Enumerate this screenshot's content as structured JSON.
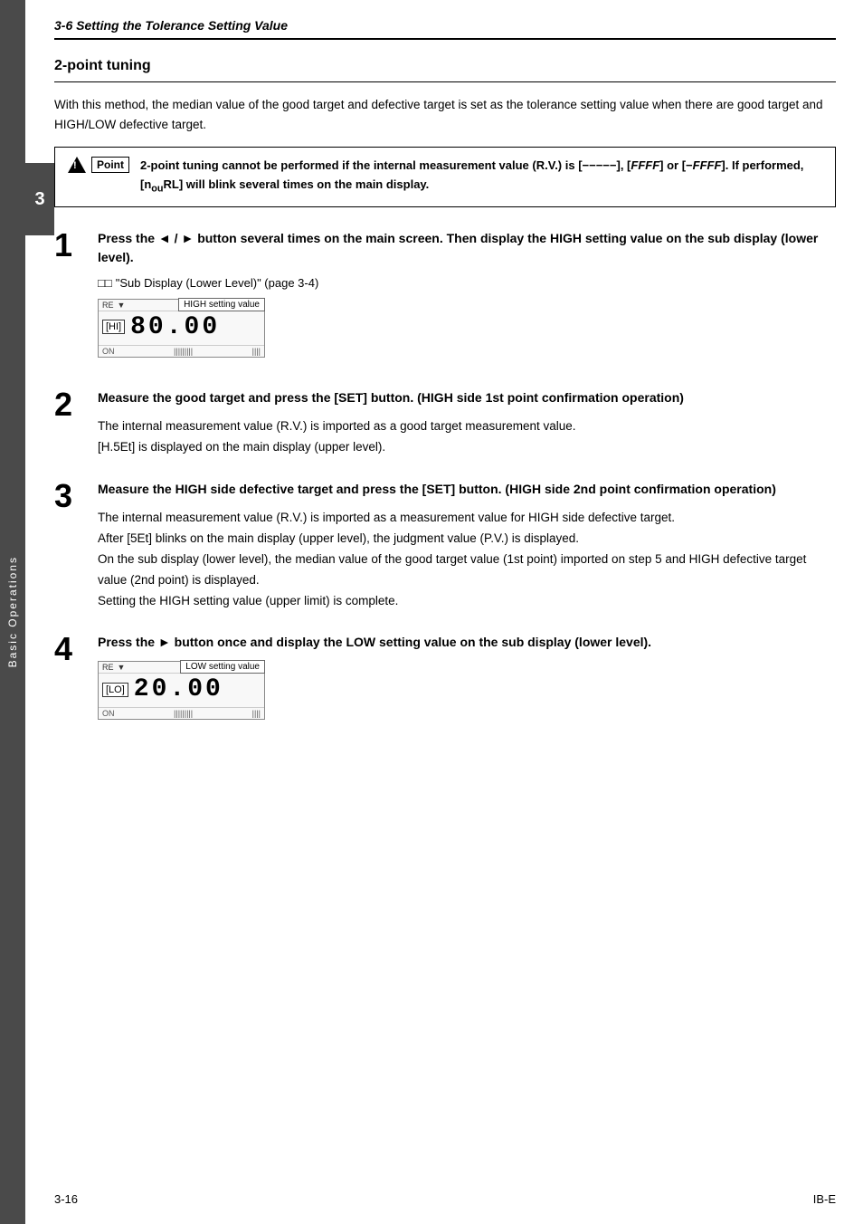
{
  "sidebar": {
    "text": "Basic Operations"
  },
  "chapter": {
    "number": "3"
  },
  "header": {
    "section": "3-6  Setting the Tolerance Setting Value"
  },
  "page": {
    "subsection_title": "2-point tuning",
    "intro": "With this method, the median value of the good target and defective target is set as the tolerance setting value when there are good target and HIGH/LOW defective target.",
    "warning": {
      "text": "2-point tuning cannot be performed if the internal measurement value (R.V.) is [-----], [FFFF] or [-FFFF]. If performed, [nquRL] will blink several times on the main display."
    },
    "steps": [
      {
        "number": "1",
        "title": "Press the ◄ / ► button several times on the main screen. Then display the HIGH setting value on the sub display (lower level).",
        "ref": "\"Sub Display (Lower Level)\" (page 3-4)",
        "display_label": "HIGH setting value",
        "display_indicator": "[HI]",
        "display_value": "80.00",
        "display_status": "ON"
      },
      {
        "number": "2",
        "title": "Measure the good target and press the [SET] button. (HIGH side 1st point confirmation operation)",
        "body_lines": [
          "The internal measurement value (R.V.) is imported as a good target measurement value.",
          "[H.5Et] is displayed on the main display (upper level)."
        ]
      },
      {
        "number": "3",
        "title": "Measure the HIGH side defective target and press the [SET] button. (HIGH side 2nd point confirmation operation)",
        "body_lines": [
          "The internal measurement value (R.V.) is imported as a measurement value for HIGH side defective target.",
          "After [5Et] blinks on the main display (upper level), the judgment value (P.V.) is displayed.",
          "On the sub display (lower level), the median value of the good target value (1st point) imported on step 5 and HIGH defective target value (2nd point) is displayed.",
          "Setting the HIGH setting value (upper limit) is complete."
        ]
      },
      {
        "number": "4",
        "title": "Press the ► button once and display the LOW setting value on the sub display (lower level).",
        "display_label": "LOW setting value",
        "display_indicator": "[LO]",
        "display_value": "20.00",
        "display_status": "ON"
      }
    ]
  },
  "footer": {
    "left": "3-16",
    "right": "IB-E"
  }
}
